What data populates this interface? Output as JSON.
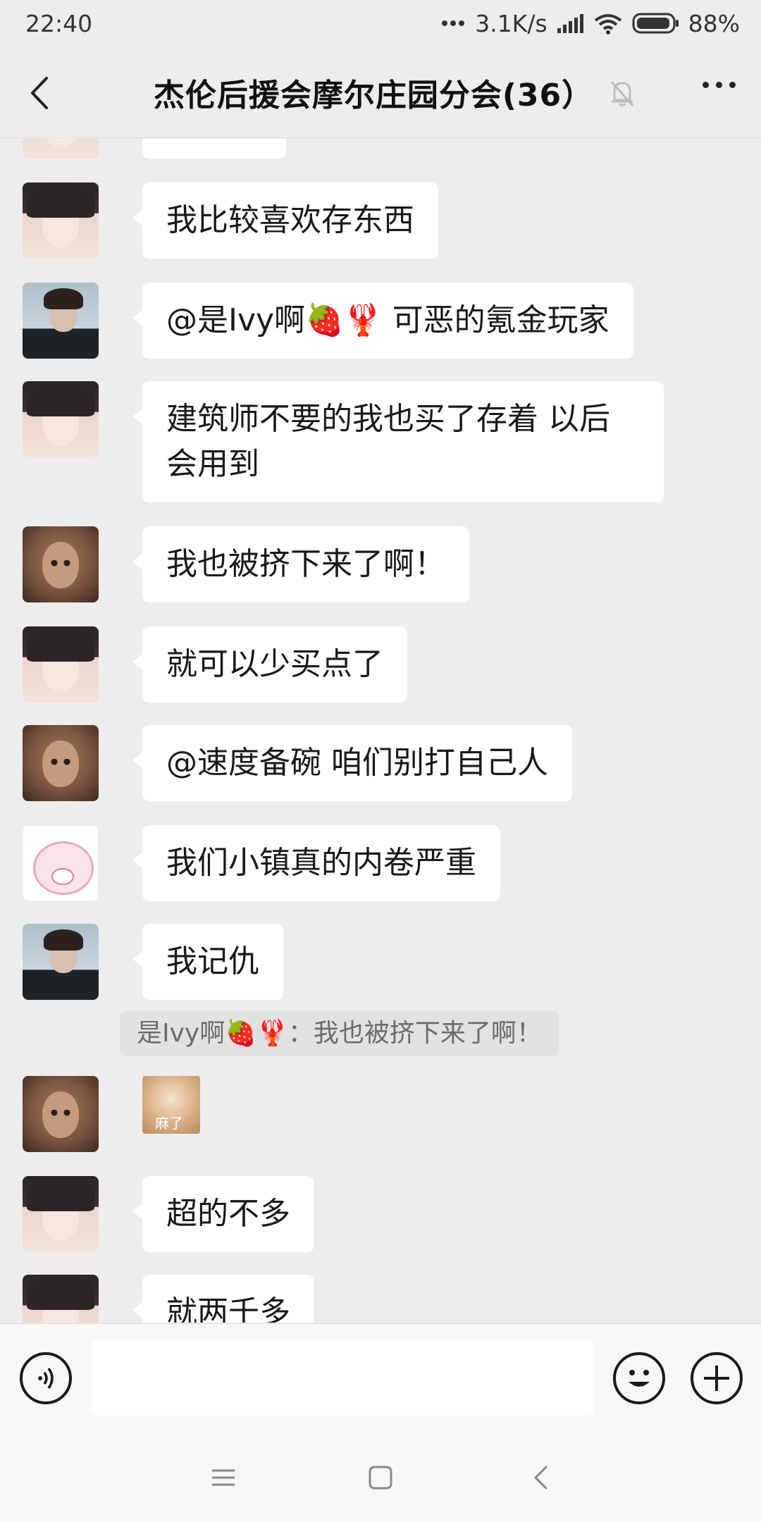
{
  "status_bar": {
    "time": "22:40",
    "network_speed": "3.1K/s",
    "battery": "88%",
    "icons": [
      "more-dots-icon",
      "signal-icon",
      "wifi-icon",
      "battery-icon"
    ]
  },
  "header": {
    "title": "杰伦后援会摩尔庄园分会(36）",
    "back_icon": "chevron-left-icon",
    "mute_icon": "bell-off-icon",
    "more_icon": "more-horizontal-icon"
  },
  "messages": [
    {
      "sender_avatar": "girl",
      "text": ""
    },
    {
      "sender_avatar": "girl",
      "text": "我比较喜欢存东西"
    },
    {
      "sender_avatar": "man",
      "text": "@是Ivy啊🍓🦞 可恶的氪金玩家"
    },
    {
      "sender_avatar": "girl",
      "text": "建筑师不要的我也买了存着  以后会用到"
    },
    {
      "sender_avatar": "doll",
      "text": "我也被挤下来了啊！"
    },
    {
      "sender_avatar": "girl",
      "text": "就可以少买点了"
    },
    {
      "sender_avatar": "doll",
      "text": "@速度备碗  咱们别打自己人"
    },
    {
      "sender_avatar": "melody",
      "text": "我们小镇真的内卷严重"
    },
    {
      "sender_avatar": "man",
      "text": "我记仇"
    },
    {
      "sender_avatar": "doll",
      "sticker_text": "麻了"
    },
    {
      "sender_avatar": "girl",
      "text": "超的不多"
    },
    {
      "sender_avatar": "girl",
      "text": "就两千多"
    }
  ],
  "quote": {
    "text": "是Ivy啊🍓🦞：我也被挤下来了啊！"
  },
  "input_bar": {
    "voice_icon": "voice-icon",
    "input_value": "",
    "emoji_icon": "emoji-icon",
    "plus_icon": "plus-icon"
  },
  "nav_bar": {
    "icons": [
      "menu-icon",
      "home-icon",
      "back-icon"
    ]
  }
}
